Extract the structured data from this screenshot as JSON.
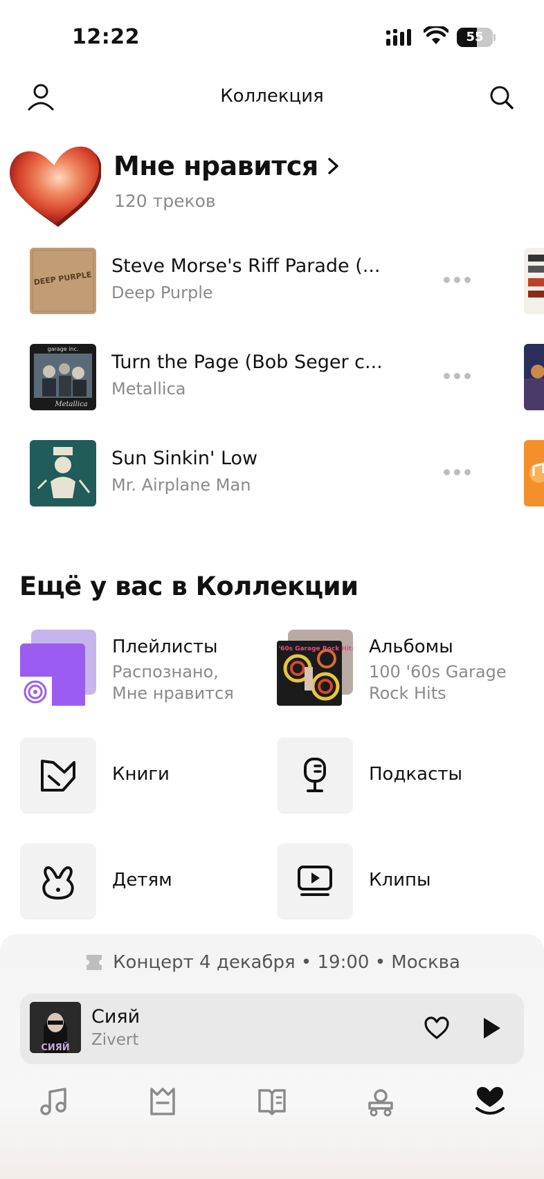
{
  "status_bar": {
    "time": "12:22",
    "battery": "55",
    "battery_fraction": 0.55
  },
  "header": {
    "title": "Коллекция",
    "icons": [
      "profile-icon",
      "search-icon"
    ]
  },
  "likes": {
    "title": "Мне нравится",
    "count": "120 треков"
  },
  "tracks": [
    {
      "title": "Steve Morse's Riff Parade (...",
      "artist": "Deep Purple",
      "cover_text": "DEEP PURPLE"
    },
    {
      "title": "Turn the Page (Bob Seger c...",
      "artist": "Metallica",
      "cover_text": "Metallica"
    },
    {
      "title": "Sun Sinkin' Low",
      "artist": "Mr. Airplane Man"
    }
  ],
  "collection": {
    "title": "Ещё у вас в Коллекции",
    "playlists": {
      "label": "Плейлисты",
      "line1": "Распознано,",
      "line2": "Мне нравится"
    },
    "albums": {
      "label": "Альбомы",
      "line1": "100 '60s Garage",
      "line2": "Rock Hits",
      "cover_text": "100 '60s Garage Rock Hits"
    },
    "books": "Книги",
    "podcasts": "Подкасты",
    "kids": "Детям",
    "clips": "Клипы"
  },
  "concert": {
    "text": "Концерт 4 декабря • 19:00 • Москва"
  },
  "player": {
    "title": "Сияй",
    "artist": "Zivert",
    "cover_text": "СИЯЙ"
  },
  "tab_bar": {
    "icons": [
      "music-note-icon",
      "map-icon",
      "book-icon",
      "kids-icon",
      "collection-heart-icon"
    ],
    "active": "collection-heart-icon"
  },
  "colors": {
    "accent_purple": "#9b5cf2",
    "heart_red": "#e4472f",
    "text_secondary": "#8a8a8a"
  }
}
